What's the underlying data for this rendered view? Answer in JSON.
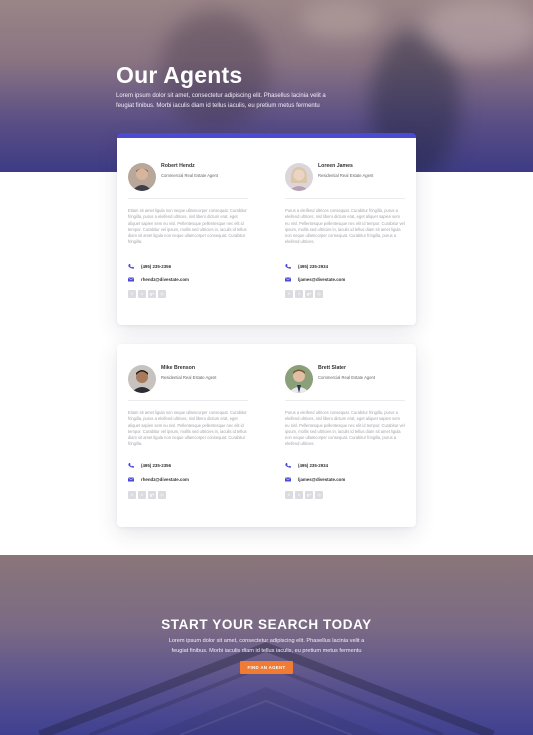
{
  "hero": {
    "title": "Our Agents",
    "text": "Lorem ipsum dolor sit amet, consectetur adipiscing elit. Phasellus lacinia velit a feugiat finibus. Morbi iaculis diam id tellus iaculis, eu pretium metus fermentu"
  },
  "colors": {
    "accent": "#4a4ad2",
    "button": "#f07b35",
    "muted_text": "#a4a4aa"
  },
  "agents": [
    {
      "name": "Robert Hendz",
      "role": "Commercial Real Estate Agent",
      "bio": "Etiam sit amet ligula non neque ullamcorper consequat. Curabitur fringilla, purus a eleifend ultrices, nisl libero dictum erat, eget aliquet sapien sem eu nisl. Pellentesque pellentesque nec elit id tempor. Curabitur vel ipsum, mollis sed ultricies in, iaculis id tellus diam sit amet ligula non neque ullamcorper consequat. Curabitur fringilla.",
      "phone": "(495) 235-2356",
      "email": "rhendz@divestate.com",
      "avatar_icon": "man-portrait-icon"
    },
    {
      "name": "Loreen James",
      "role": "Residential Real Estate Agent",
      "bio": "Purus a eleifend ultrices consequat. Curabitur fringilla, purus a eleifend ultrices, nisl libero dictum erat, eget aliquet sapien sem eu nisl. Pellentesque pellentesque nec elit id tempor. Curabitur vel ipsum, mollis sed ultricies in, iaculis id tellus diam sit amet ligula non neque ullamcorper consequat. Curabitur fringilla, purus a eleifend ultrices.",
      "phone": "(495) 235-2934",
      "email": "ljames@divestate.com",
      "avatar_icon": "woman-portrait-icon"
    },
    {
      "name": "Mike Brenson",
      "role": "Residential Real Estate Agent",
      "bio": "Etiam sit amet ligula non neque ullamcorper consequat. Curabitur fringilla, purus a eleifend ultrices, nisl libero dictum erat, eget aliquet sapien sem eu nisl. Pellentesque pellentesque nec elit id tempor. Curabitur vel ipsum, mollis sed ultricies in, iaculis id tellus diam sit amet ligula non neque ullamcorper consequat. Curabitur fringilla.",
      "phone": "(495) 235-2356",
      "email": "rhendz@divestate.com",
      "avatar_icon": "man-portrait-icon"
    },
    {
      "name": "Brett Slater",
      "role": "Commercial Real Estate Agent",
      "bio": "Purus a eleifend ultrices consequat. Curabitur fringilla, purus a eleifend ultrices, nisl libero dictum erat, eget aliquet sapien sem eu nisl. Pellentesque pellentesque nec elit id tempor. Curabitur vel ipsum, mollis sed ultricies in, iaculis id tellus diam sit amet ligula non neque ullamcorper consequat. Curabitur fringilla, purus a eleifend ultrices.",
      "phone": "(495) 235-2934",
      "email": "ljames@divestate.com",
      "avatar_icon": "man-portrait-icon"
    }
  ],
  "social_icons": [
    "facebook-icon",
    "twitter-icon",
    "google-plus-icon",
    "instagram-icon"
  ],
  "social_glyphs": [
    "f",
    "t",
    "g+",
    "◎"
  ],
  "cta": {
    "title": "START YOUR SEARCH TODAY",
    "text": "Lorem ipsum dolor sit amet, consectetur adipiscing elit. Phasellus lacinia velit a feugiat finibus. Morbi iaculis diam id tellus iaculis, eu pretium metus fermentu",
    "button": "FIND AN AGENT"
  }
}
